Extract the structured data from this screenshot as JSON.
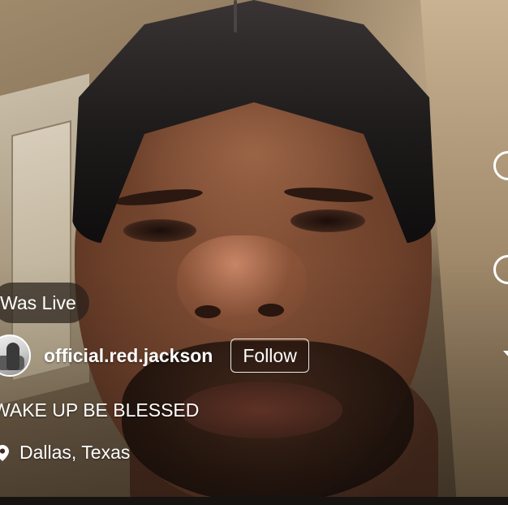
{
  "live_badge": {
    "label": "Was Live"
  },
  "user": {
    "username": "official.red.jackson",
    "avatar_icon": "profile-avatar"
  },
  "follow_button": {
    "label": "Follow"
  },
  "caption": {
    "text": "WAKE UP BE BLESSED"
  },
  "location": {
    "icon": "location-pin-icon",
    "text": "Dallas, Texas"
  },
  "side_actions": {
    "icons": [
      "action-circle-icon",
      "action-circle-icon",
      "chevron-icon"
    ]
  },
  "colors": {
    "overlay_text": "#ffffff",
    "pill_background": "#28201a"
  }
}
